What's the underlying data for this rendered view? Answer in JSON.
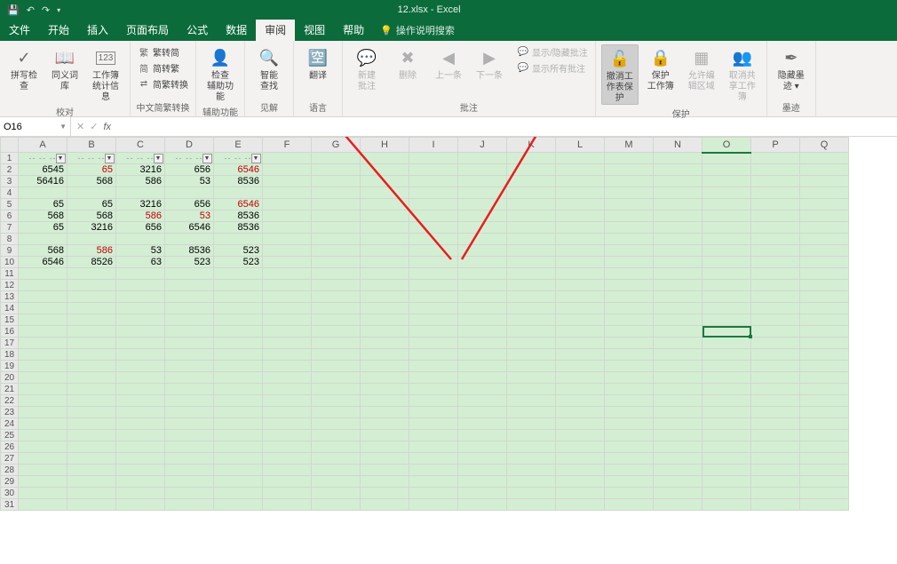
{
  "title": "12.xlsx  -  Excel",
  "qat": {
    "save": "💾",
    "undo": "↶",
    "redo": "↷"
  },
  "menu": {
    "tabs": [
      "文件",
      "开始",
      "插入",
      "页面布局",
      "公式",
      "数据",
      "审阅",
      "视图",
      "帮助"
    ],
    "active_index": 6,
    "tell_me": "操作说明搜索"
  },
  "ribbon": {
    "proofing": {
      "label": "校对",
      "spellcheck": "拼写检查",
      "thesaurus": "同义词库",
      "stats": "工作簿\n统计信息"
    },
    "chinese": {
      "label": "中文简繁转换",
      "t2s": "繁转简",
      "s2t": "简转繁",
      "conv": "简繁转换"
    },
    "accessibility": {
      "label": "辅助功能",
      "check": "检查\n辅助功能"
    },
    "insights": {
      "label": "见解",
      "smart": "智能\n查找"
    },
    "language": {
      "label": "语言",
      "translate": "翻译"
    },
    "comments": {
      "label": "批注",
      "new": "新建\n批注",
      "delete": "删除",
      "prev": "上一条",
      "next": "下一条",
      "showhide": "显示/隐藏批注",
      "showall": "显示所有批注"
    },
    "protect": {
      "label": "保护",
      "unprotect_sheet": "撤消工\n作表保护",
      "protect_wb": "保护\n工作簿",
      "allow_edit": "允许编\n辑区域",
      "unshare": "取消共\n享工作簿"
    },
    "ink": {
      "label": "墨迹",
      "hide": "隐藏墨\n迹 ▾"
    }
  },
  "namebox": "O16",
  "columns": [
    "A",
    "B",
    "C",
    "D",
    "E",
    "F",
    "G",
    "H",
    "I",
    "J",
    "K",
    "L",
    "M",
    "N",
    "O",
    "P",
    "Q"
  ],
  "selected_col": "O",
  "selected_row": 16,
  "data_rows": [
    {
      "r": 2,
      "v": [
        "6545",
        "65",
        "3216",
        "656",
        "6546"
      ],
      "red": [
        1,
        4
      ]
    },
    {
      "r": 3,
      "v": [
        "56416",
        "568",
        "586",
        "53",
        "8536"
      ],
      "red": []
    },
    {
      "r": 5,
      "v": [
        "65",
        "65",
        "3216",
        "656",
        "6546"
      ],
      "red": [
        4
      ]
    },
    {
      "r": 6,
      "v": [
        "568",
        "568",
        "586",
        "53",
        "8536"
      ],
      "red": [
        2,
        3
      ]
    },
    {
      "r": 7,
      "v": [
        "65",
        "3216",
        "656",
        "6546",
        "8536"
      ],
      "red": []
    },
    {
      "r": 9,
      "v": [
        "568",
        "586",
        "53",
        "8536",
        "523"
      ],
      "red": [
        1
      ]
    },
    {
      "r": 10,
      "v": [
        "6546",
        "8526",
        "63",
        "523",
        "523"
      ],
      "red": []
    }
  ],
  "row_count": 31,
  "filter_placeholder": "-- -- --"
}
